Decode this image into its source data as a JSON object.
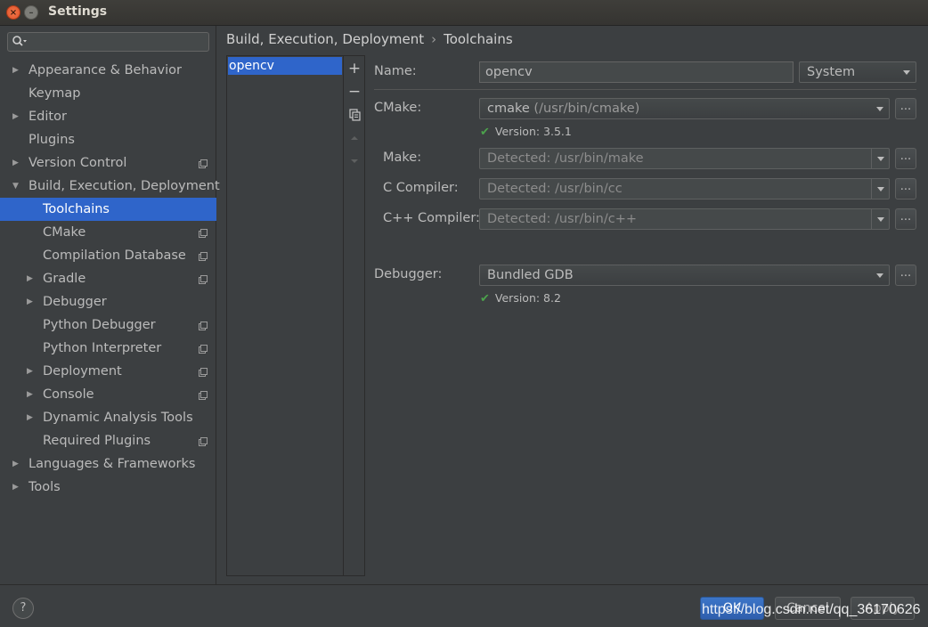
{
  "window": {
    "title": "Settings",
    "close_glyph": "×",
    "minimize_glyph": "–"
  },
  "search": {
    "placeholder": ""
  },
  "sidebar": {
    "items": [
      {
        "label": "Appearance & Behavior",
        "arrow": "▶"
      },
      {
        "label": "Keymap"
      },
      {
        "label": "Editor",
        "arrow": "▶"
      },
      {
        "label": "Plugins"
      },
      {
        "label": "Version Control",
        "arrow": "▶"
      },
      {
        "label": "Build, Execution, Deployment",
        "arrow": "▼"
      },
      {
        "label": "Toolchains"
      },
      {
        "label": "CMake"
      },
      {
        "label": "Compilation Database"
      },
      {
        "label": "Gradle",
        "arrow": "▶"
      },
      {
        "label": "Debugger",
        "arrow": "▶"
      },
      {
        "label": "Python Debugger"
      },
      {
        "label": "Python Interpreter"
      },
      {
        "label": "Deployment",
        "arrow": "▶"
      },
      {
        "label": "Console",
        "arrow": "▶"
      },
      {
        "label": "Dynamic Analysis Tools",
        "arrow": "▶"
      },
      {
        "label": "Required Plugins"
      },
      {
        "label": "Languages & Frameworks",
        "arrow": "▶"
      },
      {
        "label": "Tools",
        "arrow": "▶"
      }
    ]
  },
  "breadcrumb": {
    "parent": "Build, Execution, Deployment",
    "separator": "›",
    "current": "Toolchains"
  },
  "toolchains": {
    "items": [
      "opencv"
    ],
    "add_glyph": "+",
    "remove_glyph": "−"
  },
  "form": {
    "name_label": "Name:",
    "name_value": "opencv",
    "type_value": "System",
    "cmake_label": "CMake:",
    "cmake_value": "cmake",
    "cmake_path": "(/usr/bin/cmake)",
    "cmake_version": "Version: 3.5.1",
    "make_label": "Make:",
    "make_value": "Detected: /usr/bin/make",
    "c_label": "C Compiler:",
    "c_value": "Detected: /usr/bin/cc",
    "cpp_label": "C++ Compiler:",
    "cpp_value": "Detected: /usr/bin/c++",
    "debugger_label": "Debugger:",
    "debugger_value": "Bundled GDB",
    "debugger_version": "Version: 8.2",
    "browse_label": "...",
    "check_glyph": "✔"
  },
  "footer": {
    "help": "?",
    "ok": "OK",
    "cancel": "Cancel",
    "apply": "Apply",
    "watermark": "https://blog.csdn.net/qq_36170626"
  },
  "colors": {
    "selection": "#2f65ca",
    "background": "#3c3f41",
    "check": "#4ca24c"
  }
}
